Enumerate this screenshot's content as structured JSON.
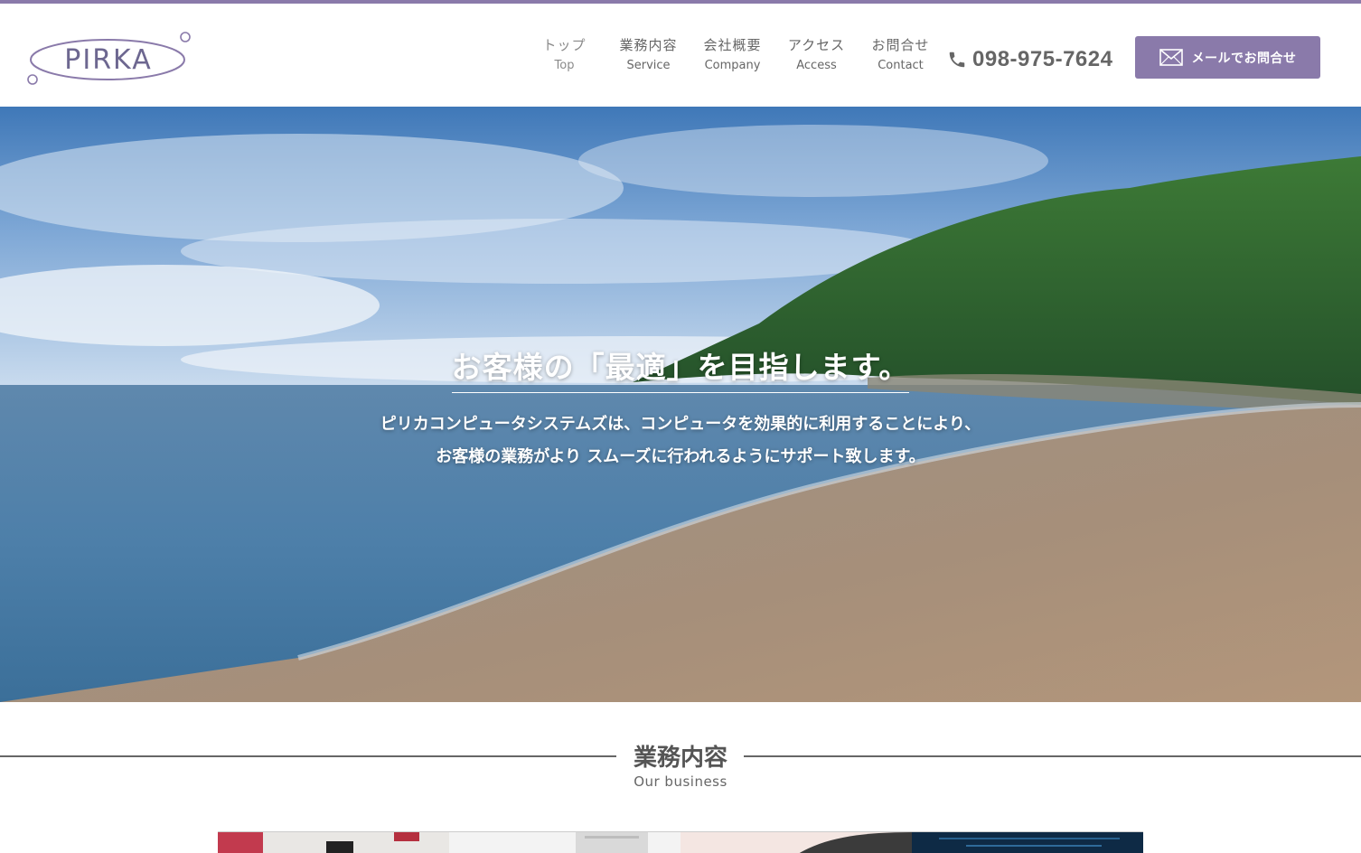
{
  "brand": {
    "logo_text": "PIRKA",
    "accent_color": "#8a7aaa"
  },
  "nav": {
    "items": [
      {
        "ja": "トップ",
        "en": "Top"
      },
      {
        "ja": "業務内容",
        "en": "Service"
      },
      {
        "ja": "会社概要",
        "en": "Company"
      },
      {
        "ja": "アクセス",
        "en": "Access"
      },
      {
        "ja": "お問合せ",
        "en": "Contact"
      }
    ]
  },
  "contact": {
    "phone": "098-975-7624",
    "phone_icon": "phone-icon",
    "mail_label": "メールでお問合せ",
    "mail_icon": "mail-icon"
  },
  "hero": {
    "title": "お客様の「最適」を目指します。",
    "line1": "ピリカコンピュータシステムズは、コンピュータを効果的に利用することにより、",
    "line2": "お客様の業務がより スムーズに行われるようにサポート致します。"
  },
  "section": {
    "title": "業務内容",
    "subtitle": "Our business"
  }
}
